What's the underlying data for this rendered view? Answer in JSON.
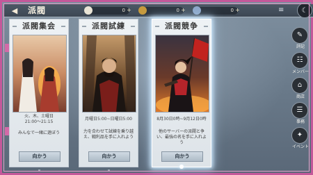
{
  "header": {
    "title": "派閥",
    "back_icon": "back-arrow-icon",
    "currencies": [
      {
        "icon": "silver-coin-icon",
        "value": "0"
      },
      {
        "icon": "gold-ingot-icon",
        "value": "0"
      },
      {
        "icon": "jade-icon",
        "value": "0"
      }
    ],
    "menu_icon": "more-menu-icon",
    "corner_icon": "moon-icon"
  },
  "cards": [
    {
      "title": "派閥集会",
      "schedule": "火、木、土曜日\n21:00～21:15",
      "description": "みんなで一緒に遊ぼう",
      "button": "向かう",
      "selected": false
    },
    {
      "title": "派閥試練",
      "schedule": "月曜日5:00~日曜日5:00",
      "description": "力を合わせて試練を乗り越え、戦利品を手に入れよう",
      "button": "向かう",
      "selected": false
    },
    {
      "title": "派閥競争",
      "schedule": "8月30日0時~9月12日0時",
      "description": "他のサーバーの派閥と争い、最強の名を手に入れよう",
      "button": "向かう",
      "selected": true
    }
  ],
  "side_buttons": [
    {
      "icon": "quill-icon",
      "label": "評記"
    },
    {
      "icon": "members-icon",
      "label": "メンバー"
    },
    {
      "icon": "shop-icon",
      "label": "商店"
    },
    {
      "icon": "tasks-icon",
      "label": "事務"
    },
    {
      "icon": "event-icon",
      "label": "イベント"
    }
  ],
  "colors": {
    "frame": "#c4589a",
    "card_bg": "#eef2f5",
    "selected_glow": "#d2ebff",
    "text_dark": "#3a3a3a"
  }
}
